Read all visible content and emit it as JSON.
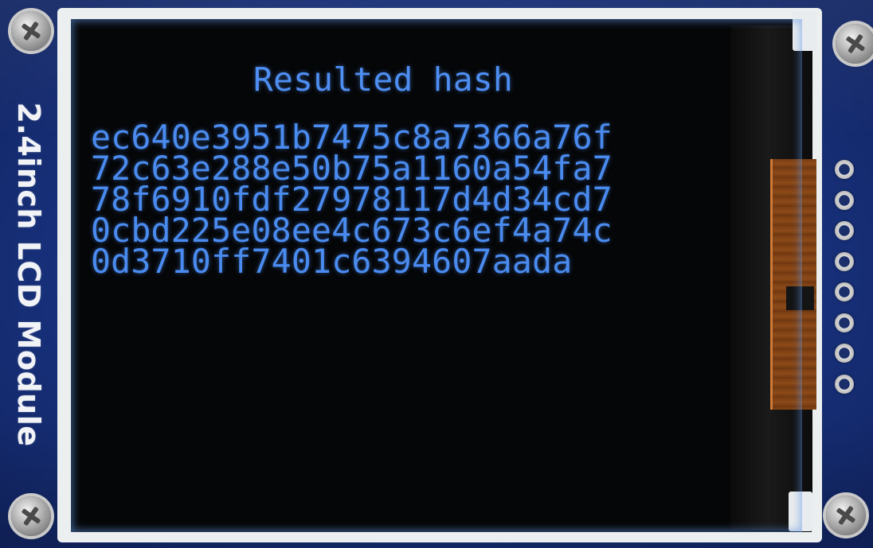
{
  "module": {
    "silkscreen_label": "2.4inch LCD Module",
    "board_color": "#17307a",
    "pin_count": 8
  },
  "lcd": {
    "title": "Resulted hash",
    "text_color": "#4a8bf0",
    "background_color": "#050607",
    "hash_lines": [
      "ec640e3951b7475c8a7366a76f",
      "72c63e288e50b75a1160a54fa7",
      "78f6910fdf27978117d4d34cd7",
      "0cbd225e08ee4c673c6ef4a74c",
      "0d3710ff7401c6394607aada"
    ]
  }
}
